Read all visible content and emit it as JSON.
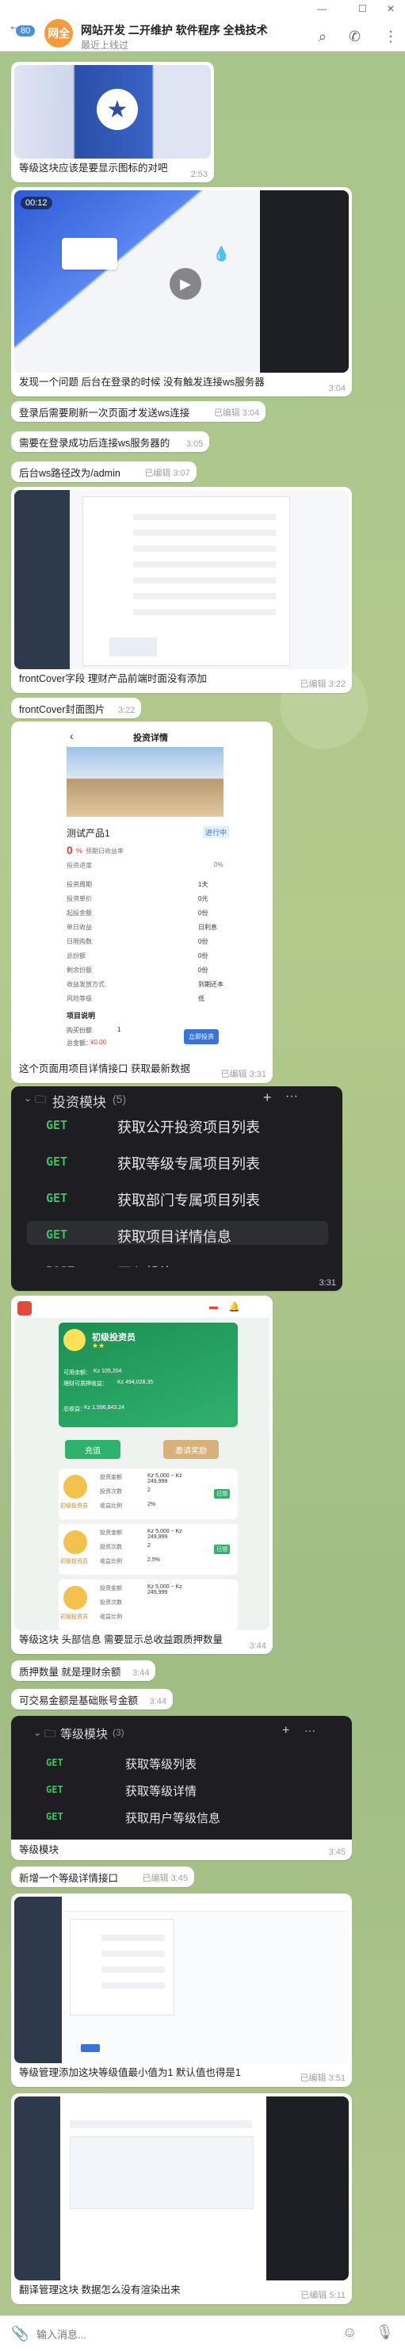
{
  "header": {
    "title": "网站开发 二开维护 软件程序 全栈技术",
    "status": "最近上线过",
    "unread": "80",
    "avatar_text": "网全"
  },
  "messages": {
    "m1": {
      "text": "等级这块应该是要显示图标的对吧",
      "time": "2:53"
    },
    "m2": {
      "text": "发现一个问题 后台在登录的时候 没有触发连接ws服务器",
      "time": "3:04",
      "duration": "00:12"
    },
    "m3": {
      "text": "登录后需要刷新一次页面才发送ws连接",
      "time": "已编辑 3:04"
    },
    "m4": {
      "text": "需要在登录成功后连接ws服务器的",
      "time": "3:05"
    },
    "m5": {
      "text": "后台ws路径改为/admin",
      "time": "已编辑 3:07"
    },
    "m6": {
      "text": "frontCover字段 理财产品前端时面没有添加",
      "time": "已编辑 3:22"
    },
    "m7": {
      "text": "frontCover封面图片",
      "time": "3:22"
    },
    "m8": {
      "text": "这个页面用项目详情接口 获取最新数据",
      "time": "已编辑 3:31"
    },
    "m9": {
      "title": "投资模块",
      "count": "(5)",
      "time": "3:31",
      "apis": [
        {
          "method": "GET",
          "label": "获取公开投资项目列表"
        },
        {
          "method": "GET",
          "label": "获取等级专属项目列表"
        },
        {
          "method": "GET",
          "label": "获取部门专属项目列表"
        },
        {
          "method": "GET",
          "label": "获取项目详情信息"
        },
        {
          "method": "POST",
          "label": "买入投资"
        }
      ]
    },
    "m10": {
      "text": "等级这块 头部信息 需要显示总收益跟质押数量",
      "time": "3:44"
    },
    "m11": {
      "text": "质押数量 就是理财余额",
      "time": "3:44"
    },
    "m12": {
      "text": "可交易金额是基础账号金额",
      "time": "3:44"
    },
    "m13": {
      "title": "等级模块",
      "count": "(3)",
      "time": "3:45",
      "caption": "等级模块",
      "apis": [
        {
          "method": "GET",
          "label": "获取等级列表"
        },
        {
          "method": "GET",
          "label": "获取等级详情"
        },
        {
          "method": "GET",
          "label": "获取用户等级信息"
        }
      ]
    },
    "m14": {
      "text": "新增一个等级详情接口",
      "time": "已编辑 3:45"
    },
    "m15": {
      "text": "等级管理添加这块等级值最小值为1 默认值也得是1",
      "time": "已编辑 3:51"
    },
    "m16": {
      "text": "翻译管理这块 数据怎么没有渲染出来",
      "time": "已编辑 5:11"
    }
  },
  "phone1": {
    "back": "‹",
    "title": "投资详情",
    "product": "测试产品1",
    "tag": "进行中",
    "rate": "0",
    "rate_unit": "%",
    "rate_label": "预期日收益率",
    "progress_label": "投资进度",
    "progress": "0%",
    "rows": [
      [
        "投资周期",
        "1天"
      ],
      [
        "投资单价",
        "0元"
      ],
      [
        "起投金额",
        "0份"
      ],
      [
        "单日收益",
        "日利息"
      ],
      [
        "日限购数",
        "0份"
      ],
      [
        "总份额",
        "0份"
      ],
      [
        "剩余份额",
        "0份"
      ],
      [
        "收益发放方式",
        "到期还本"
      ],
      [
        "风险等级",
        "低"
      ]
    ],
    "desc_title": "项目说明",
    "buy_label": "购买份额",
    "qty": "1",
    "total_label": "总金额：",
    "total": "¥0.00",
    "buy_btn": "立即投资"
  },
  "phone2": {
    "level": "初级投资员",
    "stars": "★★",
    "bal1_label": "可用余额：",
    "bal1": "Kz 105,204",
    "bal2_label": "理财可质押收益：",
    "bal2": "Kz 494,028.35",
    "bal3_label": "总收益：",
    "bal3": "Kz 1,596,843.24",
    "btn1": "充值",
    "btn2": "邀请奖励",
    "cards": [
      {
        "name": "初级投资员",
        "a": "Kz 5,000 ~ Kz 249,999",
        "b": "2",
        "c": "2%",
        "tag": "已领"
      },
      {
        "name": "初级投资员",
        "a": "Kz 5,000 ~ Kz 249,999",
        "b": "2",
        "c": "2.5%",
        "tag": "已领"
      },
      {
        "name": "初级投资员",
        "a": "Kz 5,000 ~ Kz 249,999",
        "b": "",
        "c": "",
        "tag": ""
      }
    ],
    "labels": [
      "投资金额",
      "投资次数",
      "收益比例"
    ]
  },
  "input": {
    "placeholder": "输入消息..."
  }
}
